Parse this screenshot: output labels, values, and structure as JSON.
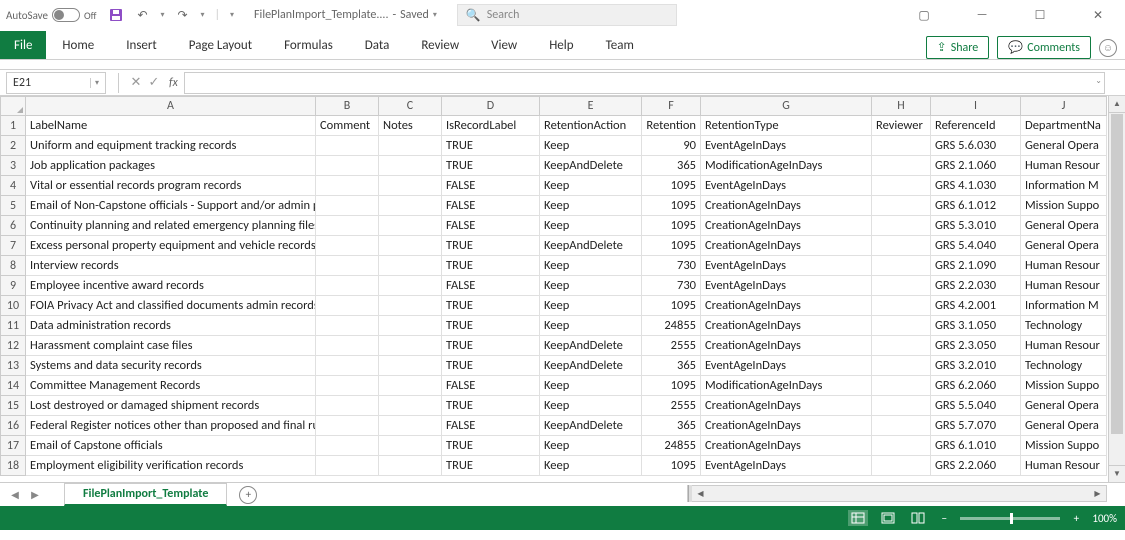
{
  "title_bar": {
    "autosave_label": "AutoSave",
    "autosave_state": "Off",
    "filename": "FilePlanImport_Template....",
    "save_state": "Saved",
    "search_placeholder": "Search"
  },
  "ribbon": {
    "file": "File",
    "tabs": [
      "Home",
      "Insert",
      "Page Layout",
      "Formulas",
      "Data",
      "Review",
      "View",
      "Help",
      "Team"
    ],
    "share": "Share",
    "comments": "Comments"
  },
  "name_box": "E21",
  "fx_label": "fx",
  "columns": {
    "letters": [
      "A",
      "B",
      "C",
      "D",
      "E",
      "F",
      "G",
      "H",
      "I",
      "J"
    ],
    "widths": [
      290,
      63,
      63,
      98,
      102,
      59,
      171,
      59,
      90,
      86
    ]
  },
  "rows": [
    {
      "n": 1,
      "A": "LabelName",
      "B": "Comment",
      "C": "Notes",
      "D": "IsRecordLabel",
      "E": "RetentionAction",
      "F": "Retention",
      "G": "RetentionType",
      "H": "Reviewer",
      "I": "ReferenceId",
      "J": "DepartmentNa"
    },
    {
      "n": 2,
      "A": "Uniform and equipment tracking records",
      "B": "",
      "C": "",
      "D": "TRUE",
      "E": "Keep",
      "F": "90",
      "G": "EventAgeInDays",
      "H": "",
      "I": "GRS 5.6.030",
      "J": "General Opera"
    },
    {
      "n": 3,
      "A": "Job application packages",
      "B": "",
      "C": "",
      "D": "TRUE",
      "E": "KeepAndDelete",
      "F": "365",
      "G": "ModificationAgeInDays",
      "H": "",
      "I": "GRS 2.1.060",
      "J": "Human Resour"
    },
    {
      "n": 4,
      "A": "Vital or essential records program records",
      "B": "",
      "C": "",
      "D": "FALSE",
      "E": "Keep",
      "F": "1095",
      "G": "EventAgeInDays",
      "H": "",
      "I": "GRS 4.1.030",
      "J": "Information M"
    },
    {
      "n": 5,
      "A": "Email of Non-Capstone officials - Support and/or admin positions",
      "B": "",
      "C": "",
      "D": "FALSE",
      "E": "Keep",
      "F": "1095",
      "G": "CreationAgeInDays",
      "H": "",
      "I": "GRS 6.1.012",
      "J": "Mission Suppo"
    },
    {
      "n": 6,
      "A": "Continuity planning and related emergency planning files",
      "B": "",
      "C": "",
      "D": "FALSE",
      "E": "Keep",
      "F": "1095",
      "G": "CreationAgeInDays",
      "H": "",
      "I": "GRS 5.3.010",
      "J": "General Opera"
    },
    {
      "n": 7,
      "A": "Excess personal property equipment and vehicle records",
      "B": "",
      "C": "",
      "D": "TRUE",
      "E": "KeepAndDelete",
      "F": "1095",
      "G": "CreationAgeInDays",
      "H": "",
      "I": "GRS 5.4.040",
      "J": "General Opera"
    },
    {
      "n": 8,
      "A": "Interview records",
      "B": "",
      "C": "",
      "D": "TRUE",
      "E": "Keep",
      "F": "730",
      "G": "EventAgeInDays",
      "H": "",
      "I": "GRS 2.1.090",
      "J": "Human Resour"
    },
    {
      "n": 9,
      "A": "Employee incentive award records",
      "B": "",
      "C": "",
      "D": "FALSE",
      "E": "Keep",
      "F": "730",
      "G": "EventAgeInDays",
      "H": "",
      "I": "GRS 2.2.030",
      "J": "Human Resour"
    },
    {
      "n": 10,
      "A": "FOIA Privacy Act and classified documents admin records",
      "B": "",
      "C": "",
      "D": "TRUE",
      "E": "Keep",
      "F": "1095",
      "G": "CreationAgeInDays",
      "H": "",
      "I": "GRS 4.2.001",
      "J": "Information M"
    },
    {
      "n": 11,
      "A": "Data administration records",
      "B": "",
      "C": "",
      "D": "TRUE",
      "E": "Keep",
      "F": "24855",
      "G": "CreationAgeInDays",
      "H": "",
      "I": "GRS 3.1.050",
      "J": "Technology"
    },
    {
      "n": 12,
      "A": "Harassment complaint case files",
      "B": "",
      "C": "",
      "D": "TRUE",
      "E": "KeepAndDelete",
      "F": "2555",
      "G": "CreationAgeInDays",
      "H": "",
      "I": "GRS 2.3.050",
      "J": "Human Resour"
    },
    {
      "n": 13,
      "A": "Systems and data security records",
      "B": "",
      "C": "",
      "D": "TRUE",
      "E": "KeepAndDelete",
      "F": "365",
      "G": "EventAgeInDays",
      "H": "",
      "I": "GRS 3.2.010",
      "J": "Technology"
    },
    {
      "n": 14,
      "A": "Committee Management Records",
      "B": "",
      "C": "",
      "D": "FALSE",
      "E": "Keep",
      "F": "1095",
      "G": "ModificationAgeInDays",
      "H": "",
      "I": "GRS 6.2.060",
      "J": "Mission Suppo"
    },
    {
      "n": 15,
      "A": "Lost destroyed or damaged shipment records",
      "B": "",
      "C": "",
      "D": "TRUE",
      "E": "Keep",
      "F": "2555",
      "G": "CreationAgeInDays",
      "H": "",
      "I": "GRS 5.5.040",
      "J": "General Opera"
    },
    {
      "n": 16,
      "A": "Federal Register notices other than proposed and final rules",
      "B": "",
      "C": "",
      "D": "FALSE",
      "E": "KeepAndDelete",
      "F": "365",
      "G": "CreationAgeInDays",
      "H": "",
      "I": "GRS 5.7.070",
      "J": "General Opera"
    },
    {
      "n": 17,
      "A": "Email of Capstone officials",
      "B": "",
      "C": "",
      "D": "TRUE",
      "E": "Keep",
      "F": "24855",
      "G": "CreationAgeInDays",
      "H": "",
      "I": "GRS 6.1.010",
      "J": "Mission Suppo"
    },
    {
      "n": 18,
      "A": "Employment eligibility verification records",
      "B": "",
      "C": "",
      "D": "TRUE",
      "E": "Keep",
      "F": "1095",
      "G": "EventAgeInDays",
      "H": "",
      "I": "GRS 2.2.060",
      "J": "Human Resour"
    }
  ],
  "sheet_tab": "FilePlanImport_Template",
  "zoom": "100%"
}
